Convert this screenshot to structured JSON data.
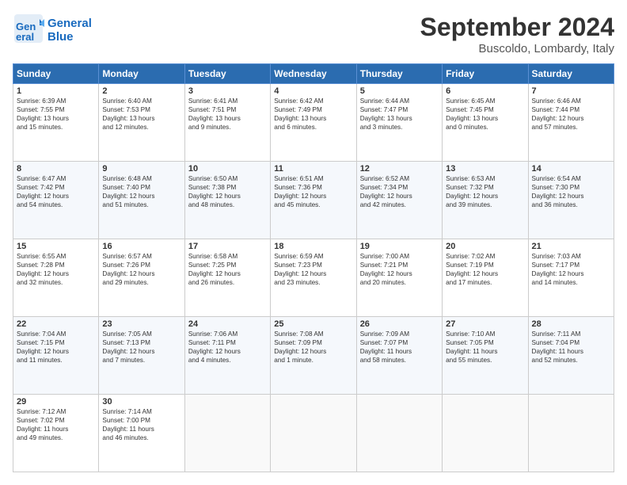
{
  "logo": {
    "line1": "General",
    "line2": "Blue"
  },
  "title": "September 2024",
  "location": "Buscoldo, Lombardy, Italy",
  "headers": [
    "Sunday",
    "Monday",
    "Tuesday",
    "Wednesday",
    "Thursday",
    "Friday",
    "Saturday"
  ],
  "rows": [
    [
      {
        "day": "1",
        "text": "Sunrise: 6:39 AM\nSunset: 7:55 PM\nDaylight: 13 hours\nand 15 minutes."
      },
      {
        "day": "2",
        "text": "Sunrise: 6:40 AM\nSunset: 7:53 PM\nDaylight: 13 hours\nand 12 minutes."
      },
      {
        "day": "3",
        "text": "Sunrise: 6:41 AM\nSunset: 7:51 PM\nDaylight: 13 hours\nand 9 minutes."
      },
      {
        "day": "4",
        "text": "Sunrise: 6:42 AM\nSunset: 7:49 PM\nDaylight: 13 hours\nand 6 minutes."
      },
      {
        "day": "5",
        "text": "Sunrise: 6:44 AM\nSunset: 7:47 PM\nDaylight: 13 hours\nand 3 minutes."
      },
      {
        "day": "6",
        "text": "Sunrise: 6:45 AM\nSunset: 7:45 PM\nDaylight: 13 hours\nand 0 minutes."
      },
      {
        "day": "7",
        "text": "Sunrise: 6:46 AM\nSunset: 7:44 PM\nDaylight: 12 hours\nand 57 minutes."
      }
    ],
    [
      {
        "day": "8",
        "text": "Sunrise: 6:47 AM\nSunset: 7:42 PM\nDaylight: 12 hours\nand 54 minutes."
      },
      {
        "day": "9",
        "text": "Sunrise: 6:48 AM\nSunset: 7:40 PM\nDaylight: 12 hours\nand 51 minutes."
      },
      {
        "day": "10",
        "text": "Sunrise: 6:50 AM\nSunset: 7:38 PM\nDaylight: 12 hours\nand 48 minutes."
      },
      {
        "day": "11",
        "text": "Sunrise: 6:51 AM\nSunset: 7:36 PM\nDaylight: 12 hours\nand 45 minutes."
      },
      {
        "day": "12",
        "text": "Sunrise: 6:52 AM\nSunset: 7:34 PM\nDaylight: 12 hours\nand 42 minutes."
      },
      {
        "day": "13",
        "text": "Sunrise: 6:53 AM\nSunset: 7:32 PM\nDaylight: 12 hours\nand 39 minutes."
      },
      {
        "day": "14",
        "text": "Sunrise: 6:54 AM\nSunset: 7:30 PM\nDaylight: 12 hours\nand 36 minutes."
      }
    ],
    [
      {
        "day": "15",
        "text": "Sunrise: 6:55 AM\nSunset: 7:28 PM\nDaylight: 12 hours\nand 32 minutes."
      },
      {
        "day": "16",
        "text": "Sunrise: 6:57 AM\nSunset: 7:26 PM\nDaylight: 12 hours\nand 29 minutes."
      },
      {
        "day": "17",
        "text": "Sunrise: 6:58 AM\nSunset: 7:25 PM\nDaylight: 12 hours\nand 26 minutes."
      },
      {
        "day": "18",
        "text": "Sunrise: 6:59 AM\nSunset: 7:23 PM\nDaylight: 12 hours\nand 23 minutes."
      },
      {
        "day": "19",
        "text": "Sunrise: 7:00 AM\nSunset: 7:21 PM\nDaylight: 12 hours\nand 20 minutes."
      },
      {
        "day": "20",
        "text": "Sunrise: 7:02 AM\nSunset: 7:19 PM\nDaylight: 12 hours\nand 17 minutes."
      },
      {
        "day": "21",
        "text": "Sunrise: 7:03 AM\nSunset: 7:17 PM\nDaylight: 12 hours\nand 14 minutes."
      }
    ],
    [
      {
        "day": "22",
        "text": "Sunrise: 7:04 AM\nSunset: 7:15 PM\nDaylight: 12 hours\nand 11 minutes."
      },
      {
        "day": "23",
        "text": "Sunrise: 7:05 AM\nSunset: 7:13 PM\nDaylight: 12 hours\nand 7 minutes."
      },
      {
        "day": "24",
        "text": "Sunrise: 7:06 AM\nSunset: 7:11 PM\nDaylight: 12 hours\nand 4 minutes."
      },
      {
        "day": "25",
        "text": "Sunrise: 7:08 AM\nSunset: 7:09 PM\nDaylight: 12 hours\nand 1 minute."
      },
      {
        "day": "26",
        "text": "Sunrise: 7:09 AM\nSunset: 7:07 PM\nDaylight: 11 hours\nand 58 minutes."
      },
      {
        "day": "27",
        "text": "Sunrise: 7:10 AM\nSunset: 7:05 PM\nDaylight: 11 hours\nand 55 minutes."
      },
      {
        "day": "28",
        "text": "Sunrise: 7:11 AM\nSunset: 7:04 PM\nDaylight: 11 hours\nand 52 minutes."
      }
    ],
    [
      {
        "day": "29",
        "text": "Sunrise: 7:12 AM\nSunset: 7:02 PM\nDaylight: 11 hours\nand 49 minutes."
      },
      {
        "day": "30",
        "text": "Sunrise: 7:14 AM\nSunset: 7:00 PM\nDaylight: 11 hours\nand 46 minutes."
      },
      {
        "day": "",
        "text": ""
      },
      {
        "day": "",
        "text": ""
      },
      {
        "day": "",
        "text": ""
      },
      {
        "day": "",
        "text": ""
      },
      {
        "day": "",
        "text": ""
      }
    ]
  ]
}
